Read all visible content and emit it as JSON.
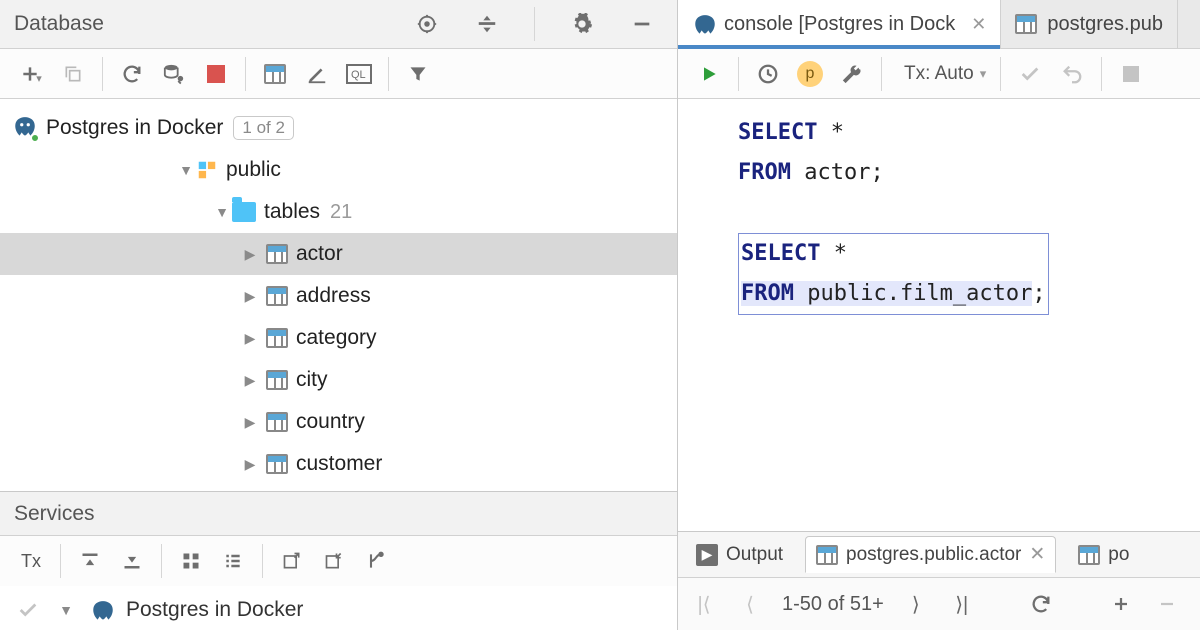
{
  "left": {
    "panel_title": "Database",
    "db_node": {
      "label": "Postgres in Docker",
      "badge": "1 of 2"
    },
    "schema_label": "public",
    "tables_group": {
      "label": "tables",
      "count": "21"
    },
    "tables": [
      "actor",
      "address",
      "category",
      "city",
      "country",
      "customer"
    ],
    "selected_table_index": 0
  },
  "services": {
    "title": "Services",
    "db_label": "Postgres in Docker"
  },
  "editor_tabs": [
    {
      "label": "console [Postgres in Dock",
      "icon": "elephant",
      "active": true,
      "closable": true
    },
    {
      "label": "postgres.pub",
      "icon": "table",
      "active": false,
      "closable": false
    }
  ],
  "editor_toolbar": {
    "tx_label": "Tx: Auto"
  },
  "sql": {
    "line1_kw": "SELECT",
    "line1_rest": " *",
    "line2_kw": "FROM",
    "line2_rest": " actor;",
    "line3_kw": "SELECT",
    "line3_rest": " *",
    "line4_kw": "FROM",
    "line4_rest": " public.film_actor",
    "line4_semi": ";"
  },
  "result_tabs": {
    "output_label": "Output",
    "actor_tab": "postgres.public.actor",
    "extra_tab": "po"
  },
  "paginator": {
    "range": "1-50 of 51+"
  }
}
